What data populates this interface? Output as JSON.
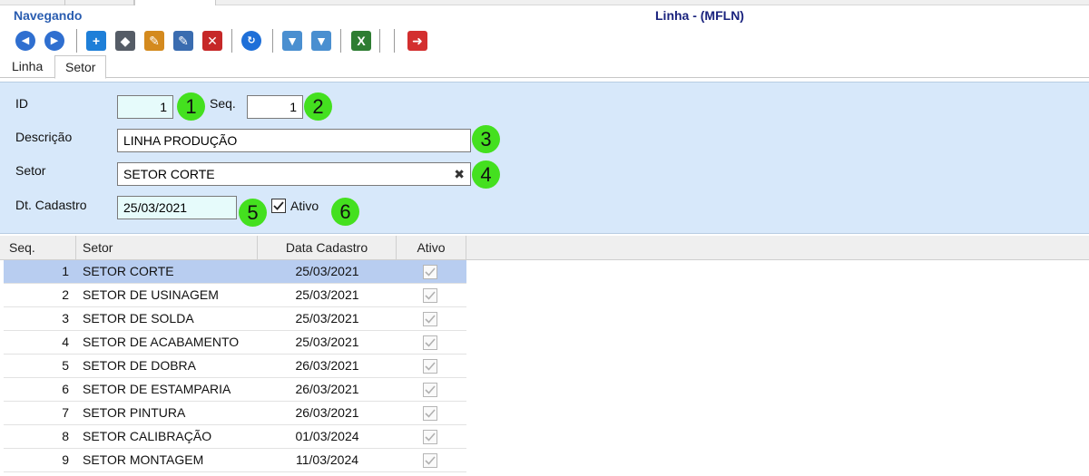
{
  "window": {
    "status_title": "Navegando",
    "form_title": "Linha - (MFLN)"
  },
  "toolbar": {
    "buttons": [
      {
        "name": "previous-button",
        "icon": "arrow-left-icon",
        "glyph": "◀",
        "color": "#2f6fd0"
      },
      {
        "name": "next-button",
        "icon": "arrow-right-icon",
        "glyph": "▶",
        "color": "#2f6fd0"
      },
      {
        "name": "new-button",
        "icon": "plus-icon",
        "glyph": "+",
        "color": "#1e7fd8"
      },
      {
        "name": "erase-button",
        "icon": "eraser-icon",
        "glyph": "◆",
        "color": "#555c66"
      },
      {
        "name": "edit-button",
        "icon": "pencil-icon",
        "glyph": "✎",
        "color": "#d48a1e"
      },
      {
        "name": "edit-record-button",
        "icon": "edit-document-icon",
        "glyph": "✎",
        "color": "#3a6cb0"
      },
      {
        "name": "delete-button",
        "icon": "delete-document-icon",
        "glyph": "✕",
        "color": "#c62828"
      },
      {
        "name": "refresh-button",
        "icon": "refresh-icon",
        "glyph": "↻",
        "color": "#1e6fd8"
      },
      {
        "name": "filter-remove-button",
        "icon": "filter-remove-icon",
        "glyph": "▼",
        "color": "#4a8fd0"
      },
      {
        "name": "filter-add-button",
        "icon": "filter-add-icon",
        "glyph": "▼",
        "color": "#4a8fd0"
      },
      {
        "name": "excel-export-button",
        "icon": "excel-icon",
        "glyph": "X",
        "color": "#2e7d32"
      },
      {
        "name": "exit-button",
        "icon": "exit-door-icon",
        "glyph": "➜",
        "color": "#d32f2f"
      }
    ]
  },
  "tabs": [
    {
      "label": "Linha",
      "active": false
    },
    {
      "label": "Setor",
      "active": true
    }
  ],
  "form": {
    "id_label": "ID",
    "id_value": "1",
    "seq_label": "Seq.",
    "seq_value": "1",
    "descricao_label": "Descrição",
    "descricao_value": "LINHA PRODUÇÃO",
    "setor_label": "Setor",
    "setor_value": "SETOR CORTE",
    "clear_glyph": "✖",
    "dt_cadastro_label": "Dt. Cadastro",
    "dt_cadastro_value": "25/03/2021",
    "ativo_label": "Ativo",
    "ativo_checked": true,
    "badges": [
      "1",
      "2",
      "3",
      "4",
      "5",
      "6"
    ]
  },
  "grid": {
    "columns": [
      "Seq.",
      "Setor",
      "Data Cadastro",
      "Ativo"
    ],
    "rows": [
      {
        "seq": "1",
        "setor": "SETOR CORTE",
        "data": "25/03/2021",
        "ativo": true,
        "selected": true
      },
      {
        "seq": "2",
        "setor": "SETOR DE USINAGEM",
        "data": "25/03/2021",
        "ativo": true,
        "selected": false
      },
      {
        "seq": "3",
        "setor": "SETOR DE SOLDA",
        "data": "25/03/2021",
        "ativo": true,
        "selected": false
      },
      {
        "seq": "4",
        "setor": "SETOR DE ACABAMENTO",
        "data": "25/03/2021",
        "ativo": true,
        "selected": false
      },
      {
        "seq": "5",
        "setor": "SETOR DE DOBRA",
        "data": "26/03/2021",
        "ativo": true,
        "selected": false
      },
      {
        "seq": "6",
        "setor": "SETOR DE ESTAMPARIA",
        "data": "26/03/2021",
        "ativo": true,
        "selected": false
      },
      {
        "seq": "7",
        "setor": "SETOR PINTURA",
        "data": "26/03/2021",
        "ativo": true,
        "selected": false
      },
      {
        "seq": "8",
        "setor": "SETOR CALIBRAÇÃO",
        "data": "01/03/2024",
        "ativo": true,
        "selected": false
      },
      {
        "seq": "9",
        "setor": "SETOR MONTAGEM",
        "data": "11/03/2024",
        "ativo": true,
        "selected": false
      }
    ]
  },
  "colors": {
    "panel_bg": "#d7e8fa",
    "selected_row": "#b8cdf0",
    "badge": "#44e01f",
    "title_blue": "#2a5db0"
  }
}
